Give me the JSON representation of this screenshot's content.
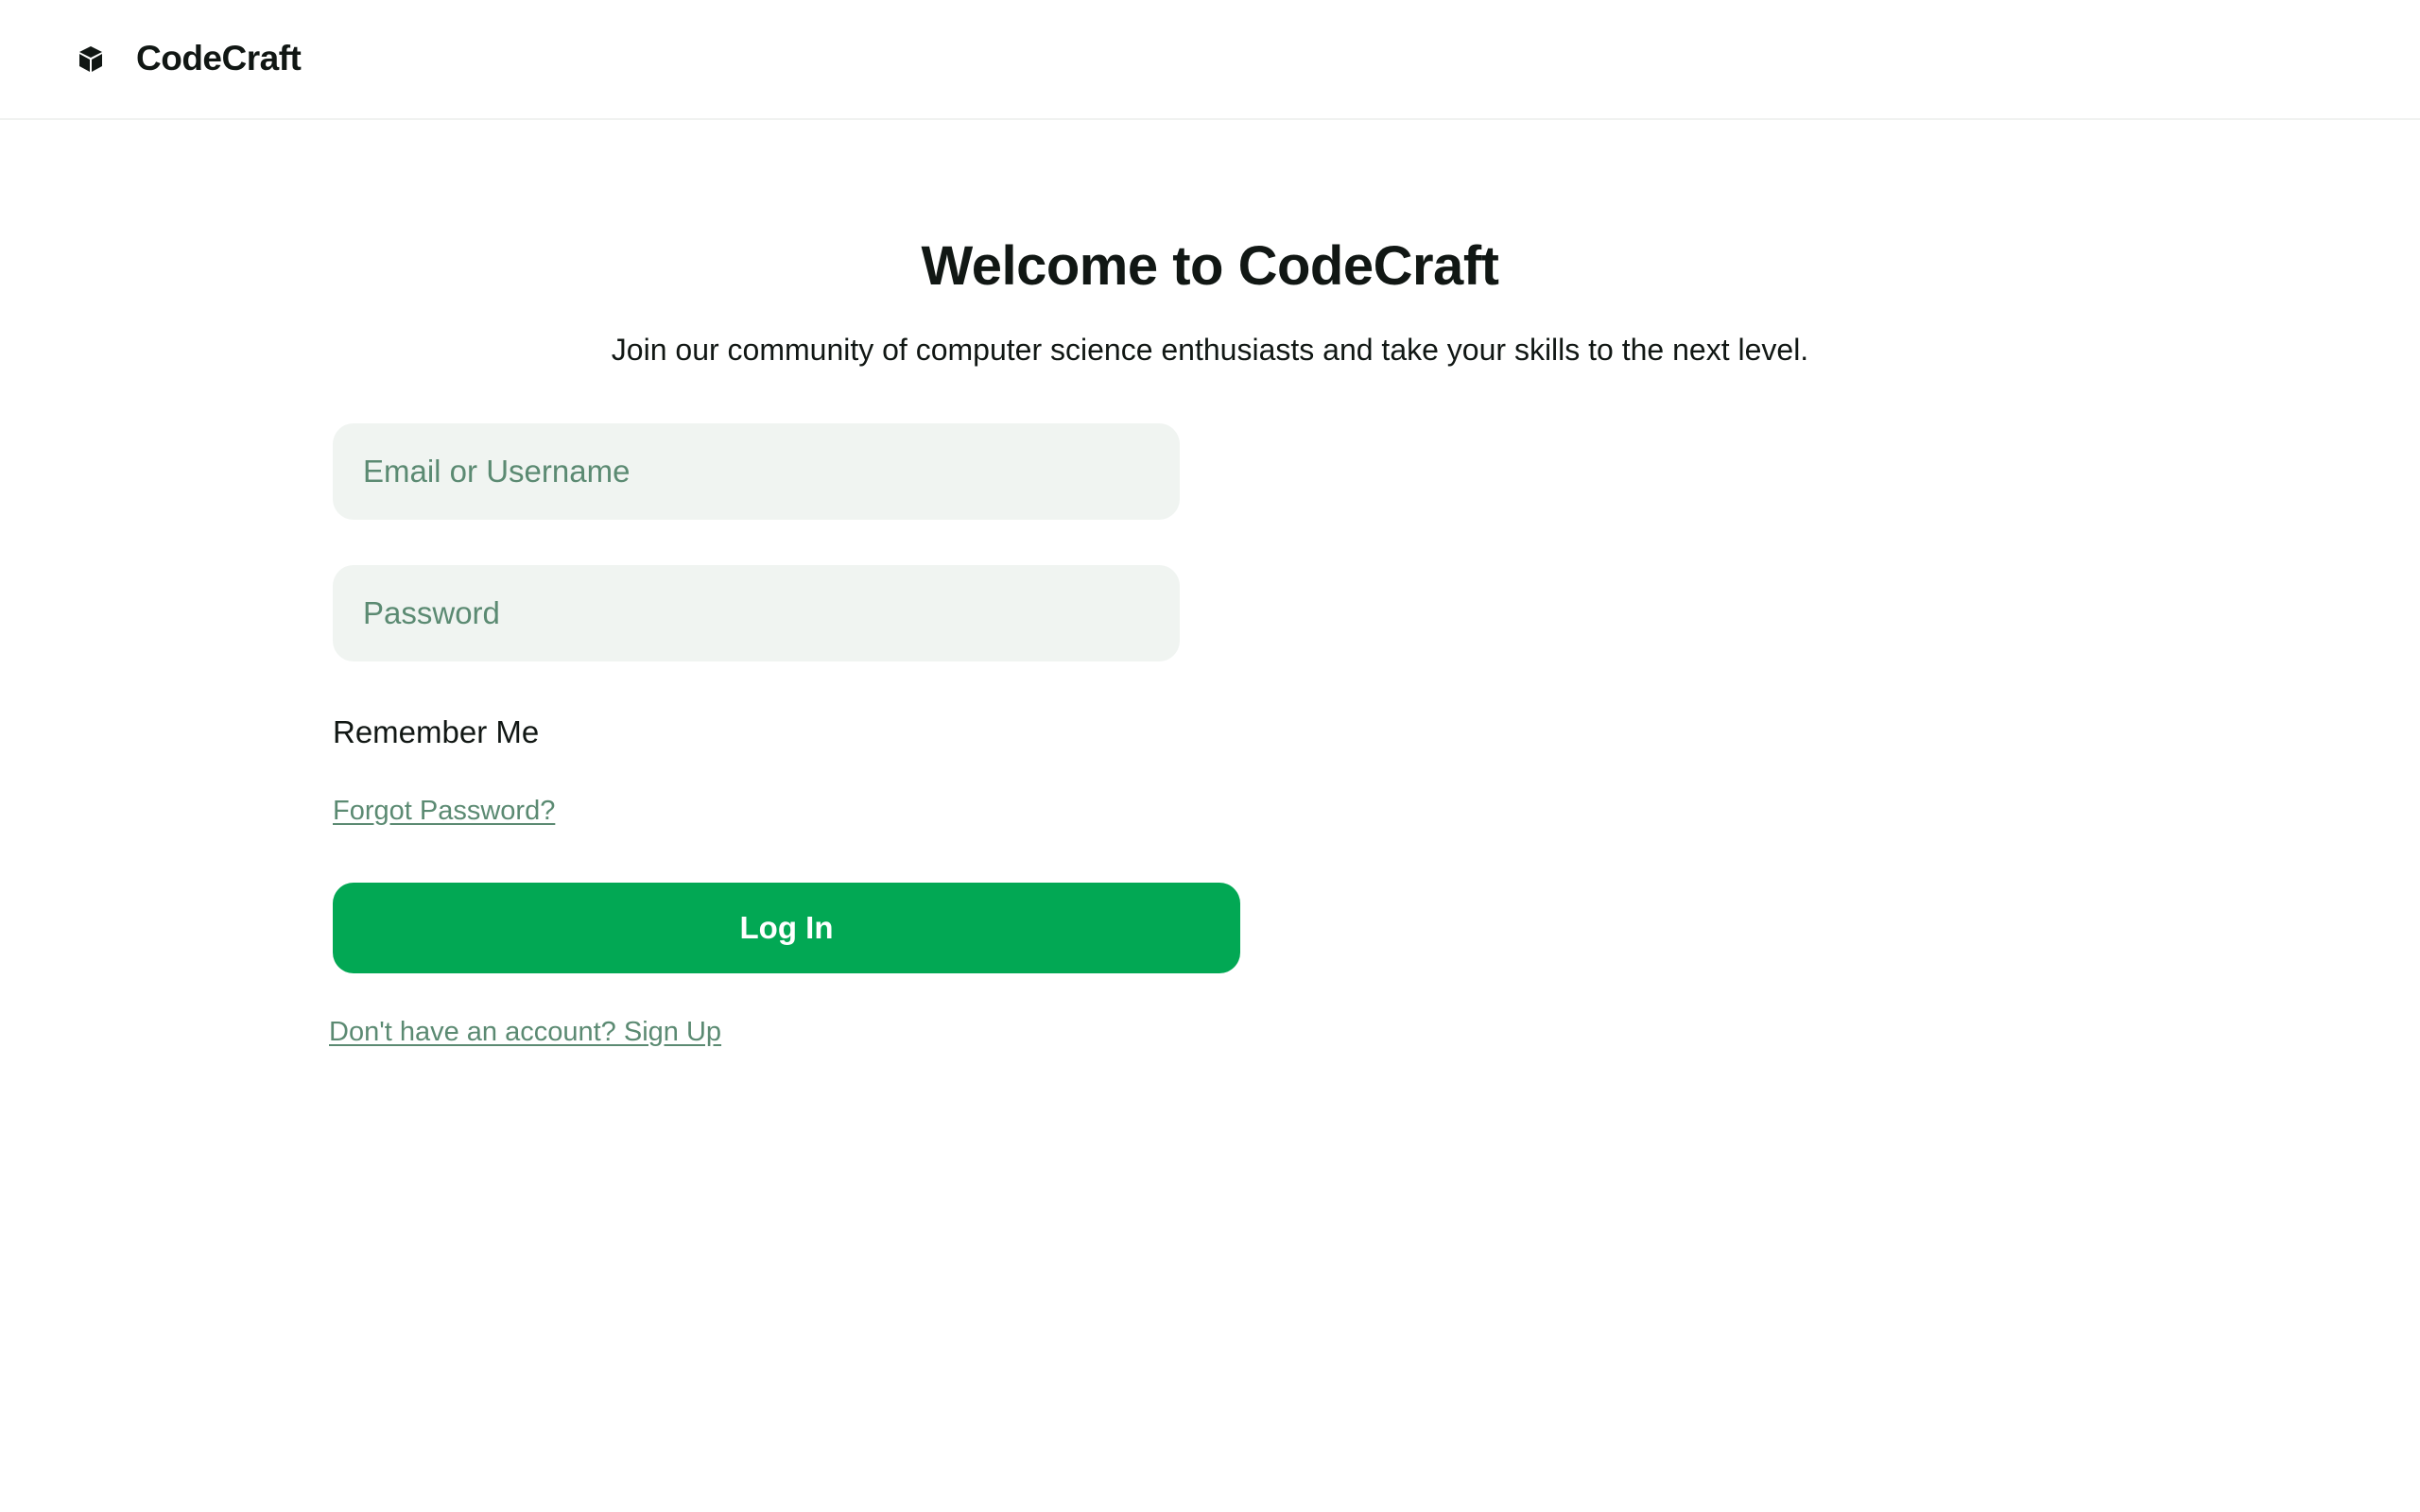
{
  "header": {
    "brand_name": "CodeCraft",
    "brand_icon": "cube-icon"
  },
  "main": {
    "title": "Welcome to CodeCraft",
    "subtitle": "Join our community of computer science enthusiasts and take your skills to the next level."
  },
  "form": {
    "email_placeholder": "Email or Username",
    "email_value": "",
    "password_placeholder": "Password",
    "password_value": "",
    "remember_label": "Remember Me",
    "forgot_link": "Forgot Password?",
    "login_label": "Log In",
    "signup_link": "Don't have an account? Sign Up"
  },
  "colors": {
    "accent": "#02a854",
    "link": "#5b8a72",
    "input_bg": "#f0f4f1",
    "text": "#111714"
  }
}
